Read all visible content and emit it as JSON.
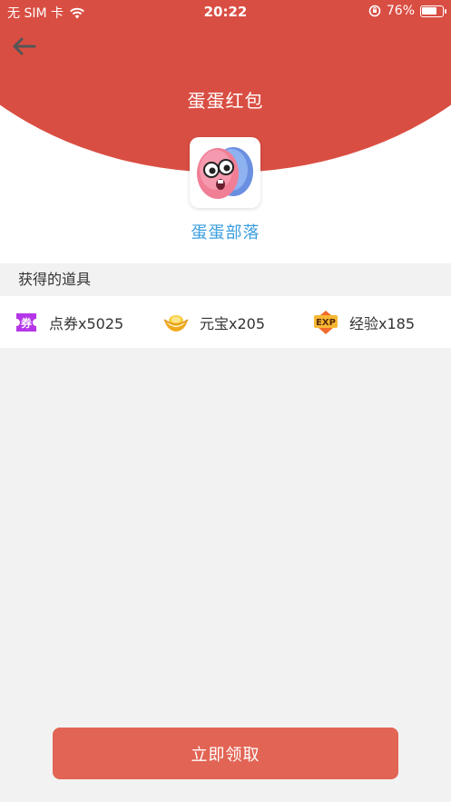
{
  "status_bar": {
    "carrier": "无 SIM 卡",
    "time": "20:22",
    "battery_percent": "76%",
    "battery_level": 0.76
  },
  "header": {
    "title": "蛋蛋红包",
    "back_icon": "arrow-left-icon"
  },
  "app": {
    "name": "蛋蛋部落",
    "logo_icon": "egg-mascot-icon"
  },
  "section": {
    "title": "获得的道具"
  },
  "items": [
    {
      "icon": "coupon-icon",
      "label": "点券x5025"
    },
    {
      "icon": "gold-ingot-icon",
      "label": "元宝x205"
    },
    {
      "icon": "exp-badge-icon",
      "label": "经验x185"
    }
  ],
  "action": {
    "claim_label": "立即领取"
  },
  "colors": {
    "header_red": "#d94e43",
    "app_name_blue": "#3a9ee0",
    "button_red": "#e26454",
    "background": "#f2f2f2"
  }
}
